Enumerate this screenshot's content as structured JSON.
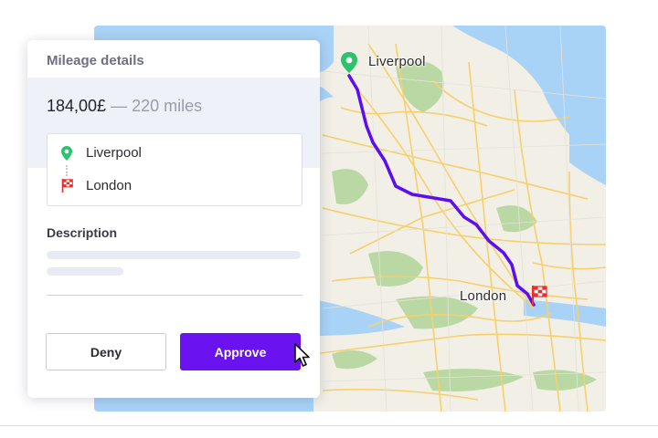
{
  "map": {
    "labels": {
      "origin": "Liverpool",
      "destination": "London"
    },
    "colors": {
      "land": "#f1efe6",
      "water": "#a9d3f6",
      "route": "#5b0eef",
      "roads": "#f7d06b",
      "parks": "#b9d8a4"
    }
  },
  "card": {
    "title": "Mileage details",
    "amount": "184,00£",
    "distance": " — 220 miles",
    "origin": "Liverpool",
    "destination": "London",
    "description_label": "Description",
    "deny_label": "Deny",
    "approve_label": "Approve",
    "accent_color": "#6a12f0"
  },
  "icons": {
    "origin": "map-pin-icon",
    "destination": "checkered-flag-icon",
    "pointer": "cursor-arrow-icon"
  }
}
